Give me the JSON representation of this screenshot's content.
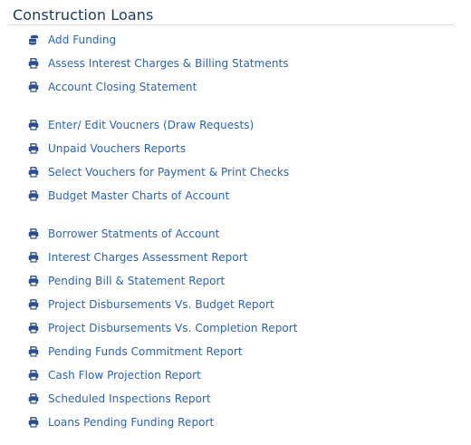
{
  "panel": {
    "title": "Construction Loans"
  },
  "theme": {
    "link_color": "#2b63b9",
    "icon_color": "#2b4f91",
    "title_color": "#1d3a66"
  },
  "menu": {
    "items": [
      {
        "label": "Add Funding",
        "icon": "coins-stack-icon"
      },
      {
        "label": "Assess Interest Charges & Billing Statments",
        "icon": "printer-icon"
      },
      {
        "label": "Account Closing Statement",
        "icon": "printer-icon"
      },
      {
        "label": "Enter/ Edit Voucners (Draw Requests)",
        "icon": "printer-icon"
      },
      {
        "label": "Unpaid Vouchers Reports",
        "icon": "printer-icon"
      },
      {
        "label": "Select Vouchers for Payment & Print Checks",
        "icon": "printer-icon"
      },
      {
        "label": "Budget Master Charts of Account",
        "icon": "printer-icon"
      },
      {
        "label": "Borrower Statments of Account",
        "icon": "printer-icon"
      },
      {
        "label": "Interest Charges Assessment Report",
        "icon": "printer-icon"
      },
      {
        "label": "Pending Bill & Statement Report",
        "icon": "printer-icon"
      },
      {
        "label": "Project Disbursements Vs. Budget Report",
        "icon": "printer-icon"
      },
      {
        "label": "Project Disbursements Vs. Completion Report",
        "icon": "printer-icon"
      },
      {
        "label": "Pending Funds Commitment Report",
        "icon": "printer-icon"
      },
      {
        "label": "Cash Flow Projection Report",
        "icon": "printer-icon"
      },
      {
        "label": "Scheduled Inspections Report",
        "icon": "printer-icon"
      },
      {
        "label": "Loans Pending Funding Report",
        "icon": "printer-icon"
      }
    ]
  }
}
